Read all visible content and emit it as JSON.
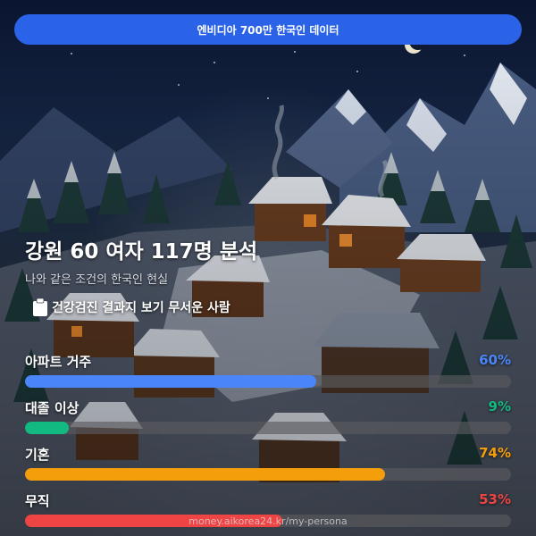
{
  "banner": {
    "text": "엔비디아 700만 한국인 데이터"
  },
  "heading": {
    "title": "강원 60 여자 117명 분석",
    "subtitle": "나와 같은 조건의 한국인 현실"
  },
  "tag": {
    "icon": "clipboard-icon",
    "text": "건강검진 결과지 보기 무서운 사람"
  },
  "stats": [
    {
      "label": "아파트 거주",
      "pct_text": "60%",
      "value": 0.6,
      "color": "#4a86f7"
    },
    {
      "label": "대졸 이상",
      "pct_text": "9%",
      "value": 0.09,
      "color": "#12b981"
    },
    {
      "label": "기혼",
      "pct_text": "74%",
      "value": 0.74,
      "color": "#f59e0b"
    },
    {
      "label": "무직",
      "pct_text": "53%",
      "value": 0.53,
      "color": "#ef4444"
    }
  ],
  "footer": {
    "text": "money.aikorea24.kr/my-persona"
  }
}
